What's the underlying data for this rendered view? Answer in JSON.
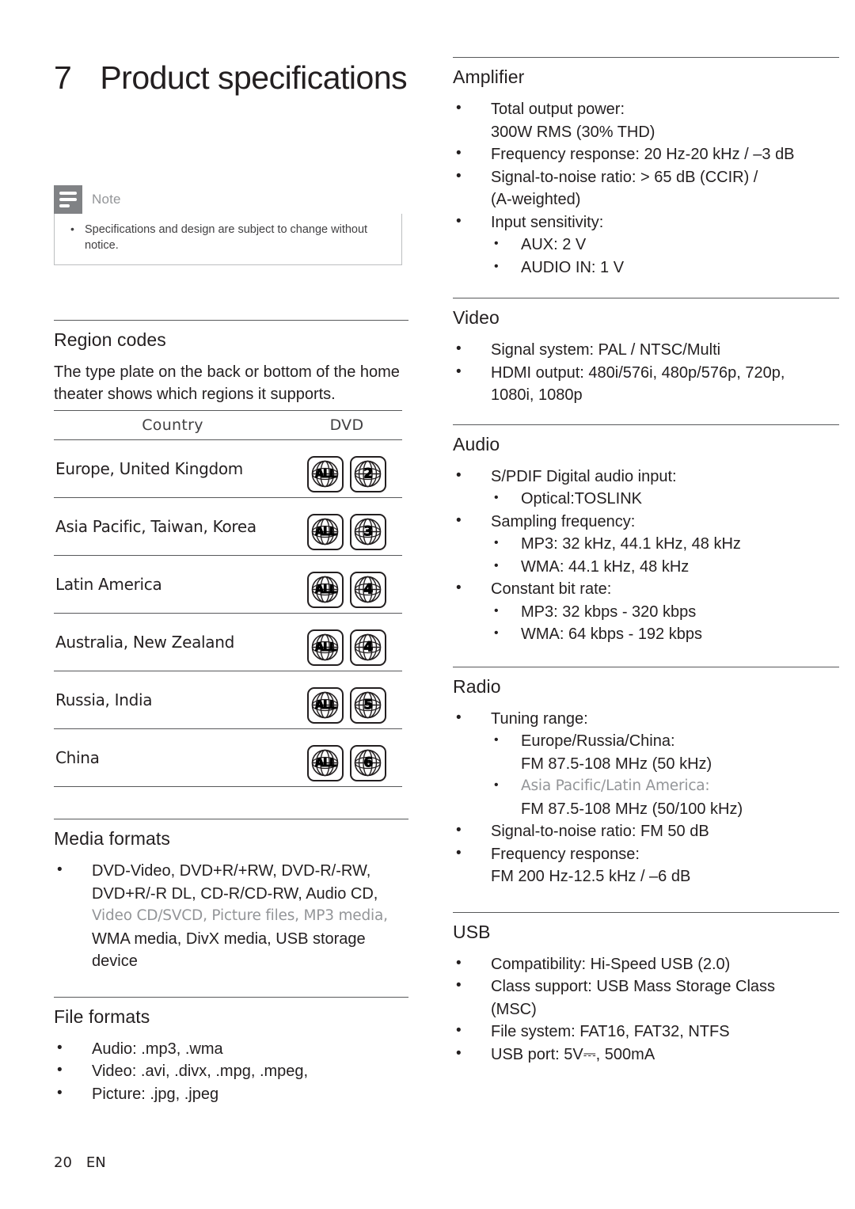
{
  "page": {
    "chapter_number": "7",
    "chapter_title": "Product specifications",
    "footer_page": "20",
    "footer_lang": "EN"
  },
  "note": {
    "icon": "note-lines-icon",
    "label": "Note",
    "items": [
      "Specifications and design are subject to change without notice."
    ]
  },
  "region_codes": {
    "title": "Region codes",
    "intro": "The type plate on the back or bottom of the home theater shows which regions it supports.",
    "columns": [
      "Country",
      "DVD"
    ],
    "rows": [
      {
        "country": "Europe, United Kingdom",
        "codes": [
          "ALL",
          "2"
        ]
      },
      {
        "country": "Asia Pacific, Taiwan, Korea",
        "codes": [
          "ALL",
          "3"
        ]
      },
      {
        "country": "Latin America",
        "codes": [
          "ALL",
          "4"
        ]
      },
      {
        "country": "Australia, New Zealand",
        "codes": [
          "ALL",
          "4"
        ]
      },
      {
        "country": "Russia, India",
        "codes": [
          "ALL",
          "5"
        ]
      },
      {
        "country": "China",
        "codes": [
          "ALL",
          "6"
        ]
      }
    ]
  },
  "media_formats": {
    "title": "Media formats",
    "line1": "DVD-Video, DVD+R/+RW, DVD-R/-RW,",
    "line2": "DVD+R/-R DL, CD-R/CD-RW, Audio CD,",
    "line3_faint": "Video CD/SVCD, Picture files, MP3 media,",
    "line4": "WMA media, DivX media, USB storage",
    "line5": "device"
  },
  "file_formats": {
    "title": "File formats",
    "items": [
      "Audio: .mp3, .wma",
      "Video: .avi, .divx, .mpg, .mpeg,",
      "Picture: .jpg, .jpeg"
    ]
  },
  "amplifier": {
    "title": "Amplifier",
    "item1_a": "Total output power:",
    "item1_b": "300W RMS (30% THD)",
    "item2": "Frequency response: 20 Hz-20 kHz / –3 dB",
    "item3_a": "Signal-to-noise ratio: > 65 dB (CCIR) /",
    "item3_b": "(A-weighted)",
    "item4": "Input sensitivity:",
    "item4_sub": [
      "AUX: 2 V",
      "AUDIO IN: 1 V"
    ]
  },
  "video": {
    "title": "Video",
    "item1": "Signal system: PAL / NTSC/Multi",
    "item2_a": "HDMI output: 480i/576i, 480p/576p, 720p,",
    "item2_b": "1080i, 1080p"
  },
  "audio": {
    "title": "Audio",
    "item1": "S/PDIF Digital audio input:",
    "item1_sub": [
      "Optical:TOSLINK"
    ],
    "item2": "Sampling frequency:",
    "item2_sub": [
      "MP3: 32 kHz, 44.1 kHz, 48 kHz",
      "WMA: 44.1 kHz, 48 kHz"
    ],
    "item3": "Constant bit rate:",
    "item3_sub": [
      "MP3: 32 kbps - 320 kbps",
      "WMA: 64 kbps - 192 kbps"
    ]
  },
  "radio": {
    "title": "Radio",
    "item1": "Tuning range:",
    "item1_sub1_a": "Europe/Russia/China:",
    "item1_sub1_b": "FM 87.5-108 MHz (50 kHz)",
    "item1_sub2_a_faint": "Asia Pacific/Latin America:",
    "item1_sub2_b": "FM 87.5-108 MHz (50/100 kHz)",
    "item2": "Signal-to-noise ratio: FM 50 dB",
    "item3_a": "Frequency response:",
    "item3_b": "FM 200 Hz-12.5 kHz / –6 dB"
  },
  "usb": {
    "title": "USB",
    "item1": "Compatibility: Hi-Speed USB (2.0)",
    "item2_a": "Class support: USB Mass Storage Class",
    "item2_b": "(MSC)",
    "item3": "File system: FAT16, FAT32, NTFS",
    "item4": "USB port: 5V⎓, 500mA"
  }
}
